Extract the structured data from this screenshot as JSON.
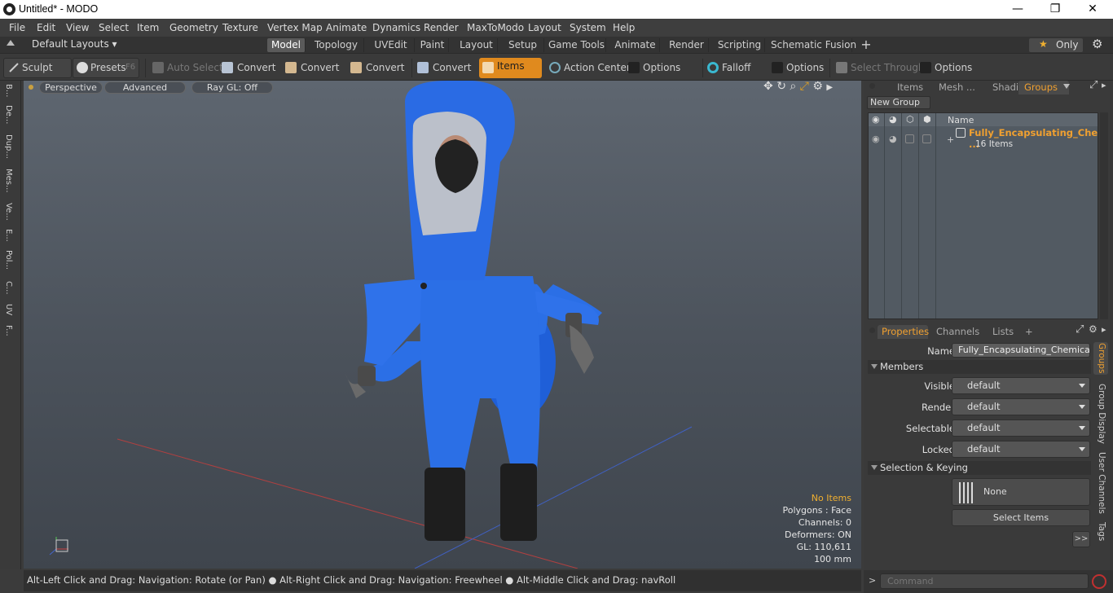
{
  "window": {
    "title": "Untitled* - MODO",
    "minimize": "—",
    "maximize": "❐",
    "close": "✕"
  },
  "menu": [
    "File",
    "Edit",
    "View",
    "Select",
    "Item",
    "Geometry",
    "Texture",
    "Vertex Map",
    "Animate",
    "Dynamics",
    "Render",
    "MaxToModo",
    "Layout",
    "System",
    "Help"
  ],
  "layoutbar": {
    "preset": "Default Layouts",
    "tabs": [
      "Model",
      "Topology",
      "UVEdit",
      "Paint",
      "Layout",
      "Setup",
      "Game Tools",
      "Animate",
      "Render",
      "Scripting",
      "Schematic Fusion"
    ],
    "active_tab": "Model",
    "add": "+",
    "only_label": "Only"
  },
  "toolbar": {
    "sculpt": "Sculpt",
    "presets": "Presets",
    "presets_key": "F6",
    "auto_select": "Auto Select",
    "convert1": "Convert",
    "convert2": "Convert",
    "convert3": "Convert",
    "convert4": "Convert",
    "items": "Items",
    "action_center": "Action Center",
    "options1": "Options",
    "falloff": "Falloff",
    "options2": "Options",
    "select_through": "Select Through",
    "options3": "Options",
    "accent_color": "#e08a1e"
  },
  "left_tabs": [
    "B...",
    "De...",
    "Dup...",
    "Mes...",
    "Ve...",
    "E...",
    "Pol...",
    "C...",
    "UV",
    "F..."
  ],
  "viewport": {
    "view_mode": "Perspective",
    "advanced": "Advanced",
    "raygl": "Ray GL: Off",
    "info": {
      "no_items": "No Items",
      "polygons": "Polygons : Face",
      "channels": "Channels: 0",
      "deformers": "Deformers: ON",
      "gl": "GL: 110,611",
      "scale": "100 mm"
    }
  },
  "status": "Alt-Left Click and Drag: Navigation: Rotate (or Pan) ● Alt-Right Click and Drag: Navigation: Freewheel ● Alt-Middle Click and Drag: navRoll",
  "right_top": {
    "tabs": [
      "Items",
      "Mesh ...",
      "Shading",
      "Groups"
    ],
    "active_tab": "Groups",
    "new_group": "New Group",
    "name_col": "Name",
    "group_name": "Fully_Encapsulating_Che ...",
    "group_count": "16 Items"
  },
  "right_bottom": {
    "tabs": [
      "Properties",
      "Channels",
      "Lists"
    ],
    "active_tab": "Properties",
    "add": "+",
    "name_label": "Name",
    "name_value": "Fully_Encapsulating_Chemical_Pr",
    "members": "Members",
    "visible_label": "Visible",
    "visible_value": "default",
    "render_label": "Render",
    "render_value": "default",
    "selectable_label": "Selectable",
    "selectable_value": "default",
    "locked_label": "Locked",
    "locked_value": "default",
    "selection_keying": "Selection & Keying",
    "none": "None",
    "select_items": "Select Items",
    "more": ">>",
    "side_tabs": [
      "Groups",
      "Group Display",
      "User Channels",
      "Tags"
    ]
  },
  "command": {
    "placeholder": "Command",
    "prompt": ">"
  }
}
